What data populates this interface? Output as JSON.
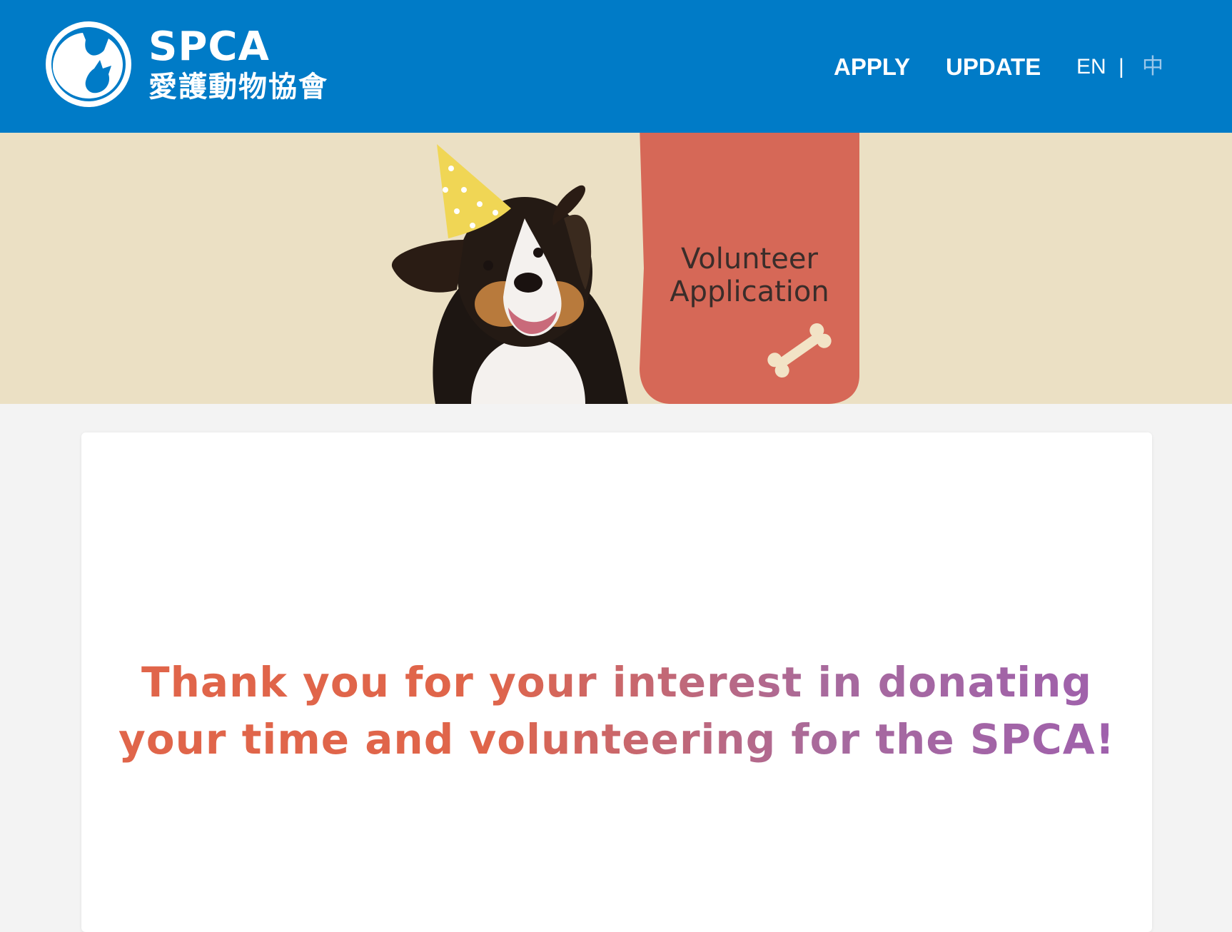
{
  "header": {
    "logo": {
      "name": "SPCA",
      "chinese_name": "愛護動物協會"
    },
    "nav": [
      {
        "label": "APPLY"
      },
      {
        "label": "UPDATE"
      }
    ],
    "language": {
      "en": "EN",
      "separator": "|",
      "zh": "中"
    }
  },
  "banner": {
    "title_line1": "Volunteer",
    "title_line2": "Application",
    "icons": [
      "dog-photo",
      "party-hat",
      "bone-icon"
    ]
  },
  "card": {
    "thanks_line1": "Thank you for your interest in donating",
    "thanks_line2": "your time and volunteering for the SPCA!"
  },
  "colors": {
    "header_bg": "#007bc7",
    "banner_bg": "#ebe0c4",
    "banner_panel": "#d66857",
    "page_bg": "#f3f3f3",
    "gradient_start": "#e0654a",
    "gradient_end": "#9e5fae"
  }
}
